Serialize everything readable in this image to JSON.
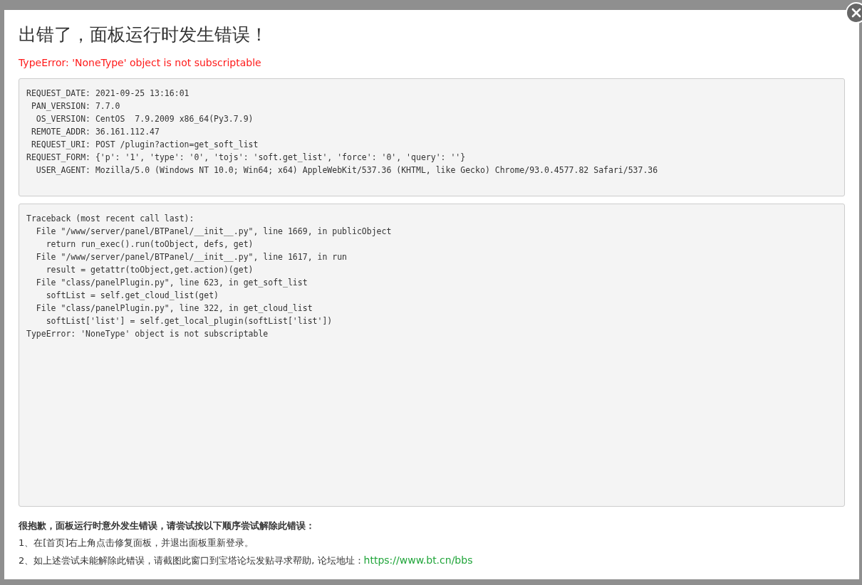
{
  "dialog": {
    "title": "出错了，面板运行时发生错误！",
    "error": "TypeError: 'NoneType' object is not subscriptable",
    "request_info": [
      "REQUEST_DATE: 2021-09-25 13:16:01",
      " PAN_VERSION: 7.7.0",
      "  OS_VERSION: CentOS  7.9.2009 x86_64(Py3.7.9)",
      " REMOTE_ADDR: 36.161.112.47",
      " REQUEST_URI: POST /plugin?action=get_soft_list",
      "REQUEST_FORM: {'p': '1', 'type': '0', 'tojs': 'soft.get_list', 'force': '0', 'query': ''}",
      "  USER_AGENT: Mozilla/5.0 (Windows NT 10.0; Win64; x64) AppleWebKit/537.36 (KHTML, like Gecko) Chrome/93.0.4577.82 Safari/537.36"
    ],
    "traceback": [
      "Traceback (most recent call last):",
      "  File \"/www/server/panel/BTPanel/__init__.py\", line 1669, in publicObject",
      "    return run_exec().run(toObject, defs, get)",
      "  File \"/www/server/panel/BTPanel/__init__.py\", line 1617, in run",
      "    result = getattr(toObject,get.action)(get)",
      "  File \"class/panelPlugin.py\", line 623, in get_soft_list",
      "    softList = self.get_cloud_list(get)",
      "  File \"class/panelPlugin.py\", line 322, in get_cloud_list",
      "    softList['list'] = self.get_local_plugin(softList['list'])",
      "TypeError: 'NoneType' object is not subscriptable"
    ],
    "help_title": "很抱歉，面板运行时意外发生错误，请尝试按以下顺序尝试解除此错误：",
    "steps": [
      {
        "text": "1、在[首页]右上角点击修复面板，并退出面板重新登录。"
      },
      {
        "text": "2、如上述尝试未能解除此错误，请截图此窗口到宝塔论坛发贴寻求帮助, 论坛地址：",
        "link": "https://www.bt.cn/bbs"
      }
    ]
  }
}
